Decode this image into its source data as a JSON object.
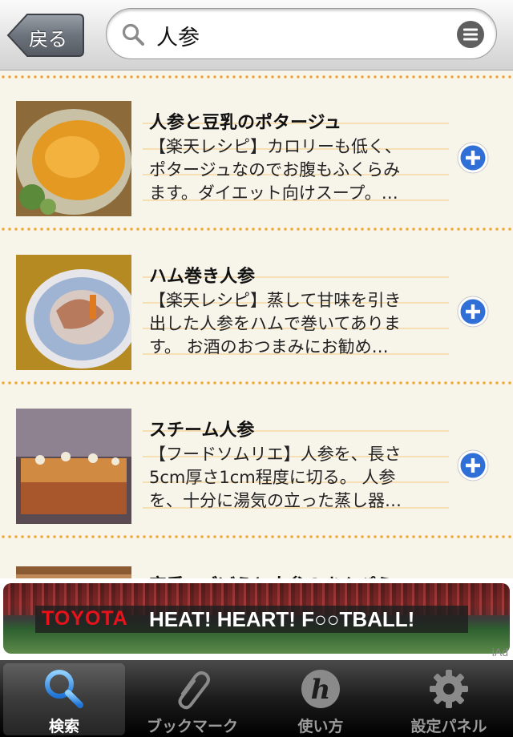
{
  "nav": {
    "back_label": "戻る",
    "search_value": "人参"
  },
  "recipes": [
    {
      "title": "人参と豆乳のポタージュ",
      "desc": [
        "【楽天レシピ】カロリーも低く、",
        "ポタージュなのでお腹もふくらみ",
        "ます。ダイエット向けスープ。…"
      ]
    },
    {
      "title": "ハム巻き人参",
      "desc": [
        "【楽天レシピ】蒸して甘味を引き",
        "出した人参をハムで巻いてありま",
        "す。 お酒のおつまみにお勧め…"
      ]
    },
    {
      "title": "スチーム人参",
      "desc": [
        "【フードソムリエ】人参を、長さ",
        "5cm厚さ1cm程度に切る。 人参",
        "を、十分に湯気の立った蒸し器…"
      ]
    },
    {
      "title": "定番◎ごぼうと人参のきんぴら",
      "desc": []
    }
  ],
  "ad": {
    "brand": "TOYOTA",
    "slogan": "HEAT! HEART! F○○TBALL!",
    "tag": "iAd"
  },
  "tabs": [
    {
      "label": "検索",
      "icon": "search-icon",
      "active": true
    },
    {
      "label": "ブックマーク",
      "icon": "paperclip-icon",
      "active": false
    },
    {
      "label": "使い方",
      "icon": "help-h-icon",
      "active": false
    },
    {
      "label": "設定パネル",
      "icon": "gear-icon",
      "active": false
    }
  ],
  "colors": {
    "accent_blue": "#2f6fd6",
    "dot_orange": "#f0a93f",
    "background": "#f7f4ea",
    "ad_red": "#e8121b"
  }
}
